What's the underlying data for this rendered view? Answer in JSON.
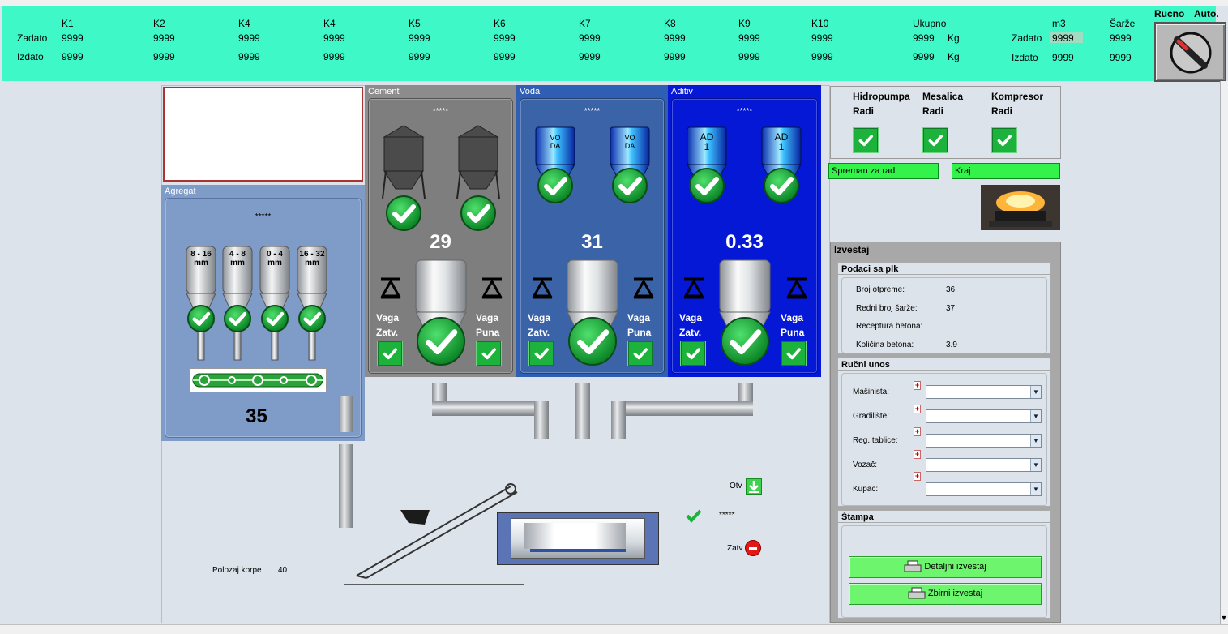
{
  "header": {
    "row_labels": {
      "set": "Zadato",
      "done": "Izdato"
    },
    "columns": [
      {
        "name": "K1",
        "set": "9999",
        "done": "9999"
      },
      {
        "name": "K2",
        "set": "9999",
        "done": "9999"
      },
      {
        "name": "K4",
        "set": "9999",
        "done": "9999"
      },
      {
        "name": "K4",
        "set": "9999",
        "done": "9999"
      },
      {
        "name": "K5",
        "set": "9999",
        "done": "9999"
      },
      {
        "name": "K6",
        "set": "9999",
        "done": "9999"
      },
      {
        "name": "K7",
        "set": "9999",
        "done": "9999"
      },
      {
        "name": "K8",
        "set": "9999",
        "done": "9999"
      },
      {
        "name": "K9",
        "set": "9999",
        "done": "9999"
      },
      {
        "name": "K10",
        "set": "9999",
        "done": "9999"
      }
    ],
    "total": {
      "name": "Ukupno",
      "set": "9999",
      "done": "9999",
      "unit": "Kg"
    },
    "m3": {
      "name": "m3",
      "set_label": "Zadato",
      "done_label": "Izdato",
      "set": "9999",
      "done": "9999"
    },
    "batches": {
      "name": "Šarže",
      "set": "9999",
      "done": "9999"
    },
    "mode": {
      "manual": "Rucno",
      "auto": "Auto."
    }
  },
  "agregat": {
    "title": "Agregat",
    "stars": "*****",
    "bins": [
      "8 - 16\nmm",
      "4 - 8\nmm",
      "0 - 4\nmm",
      "16 - 32\nmm"
    ],
    "bin_lines": [
      [
        "8 - 16",
        "mm"
      ],
      [
        "4 - 8",
        "mm"
      ],
      [
        "0 - 4",
        "mm"
      ],
      [
        "16 - 32",
        "mm"
      ]
    ],
    "value": "35"
  },
  "cement": {
    "title": "Cement",
    "stars": "*****",
    "value": "29",
    "vaga_left": [
      "Vaga",
      "Zatv."
    ],
    "vaga_right": [
      "Vaga",
      "Puna"
    ]
  },
  "voda": {
    "title": "Voda",
    "stars": "*****",
    "value": "31",
    "silo_label": [
      "VO",
      "DA"
    ],
    "vaga_left": [
      "Vaga",
      "Zatv."
    ],
    "vaga_right": [
      "Vaga",
      "Puna"
    ]
  },
  "aditiv": {
    "title": "Aditiv",
    "stars": "*****",
    "value": "0.33",
    "silo_label": [
      "AD",
      "1"
    ],
    "vaga_left": [
      "Vaga",
      "Zatv."
    ],
    "vaga_right": [
      "Vaga",
      "Puna"
    ]
  },
  "mixer": {
    "open_label": "Otv",
    "stars": "*****",
    "close_label": "Zatv",
    "basket_label": "Polozaj korpe",
    "basket_value": "40"
  },
  "status": {
    "items": [
      {
        "name": "Hidropumpa",
        "state": "Radi"
      },
      {
        "name": "Mesalica",
        "state": "Radi"
      },
      {
        "name": "Kompresor",
        "state": "Radi"
      }
    ],
    "ready": "Spreman za rad",
    "end": "Kraj"
  },
  "report": {
    "title": "Izvestaj",
    "plc": {
      "title": "Podaci sa plk",
      "rows": [
        {
          "label": "Broj otpreme:",
          "value": "36"
        },
        {
          "label": "Redni broj šarže:",
          "value": "37"
        },
        {
          "label": "Receptura betona:",
          "value": ""
        },
        {
          "label": "Količina betona:",
          "value": "3.9"
        }
      ]
    },
    "manual": {
      "title": "Ručni unos",
      "fields": [
        "Mašinista:",
        "Gradilište:",
        "Reg. tablice:",
        "Vozač:",
        "Kupac:"
      ]
    },
    "print": {
      "title": "Štampa",
      "detail": "Detaljni izvestaj",
      "summary": "Zbirni izvestaj"
    }
  },
  "colors": {
    "header": "#3ff8c8",
    "cement": "#8c8c8c",
    "voda": "#2f5fb5",
    "aditiv": "#0518d6",
    "agregat": "#7f9cc9",
    "ok_green": "#1db23c"
  }
}
